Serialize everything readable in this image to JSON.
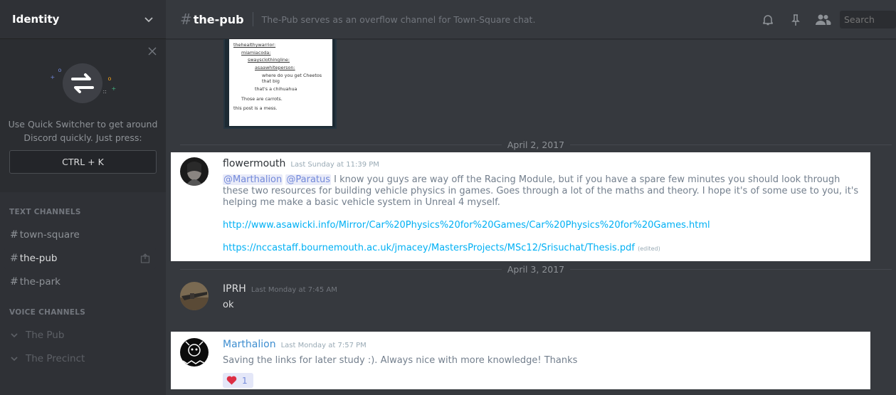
{
  "sidebar": {
    "guild_name": "Identity",
    "quick_switcher": {
      "text": "Use Quick Switcher to get around Discord quickly. Just press:",
      "shortcut": "CTRL + K"
    },
    "text_category": "TEXT CHANNELS",
    "text_channels": [
      {
        "hash": "#",
        "name": "town-square"
      },
      {
        "hash": "#",
        "name": "the-pub"
      },
      {
        "hash": "#",
        "name": "the-park"
      }
    ],
    "voice_category": "VOICE CHANNELS",
    "voice_channels": [
      {
        "name": "The Pub"
      },
      {
        "name": "The Precinct"
      }
    ]
  },
  "header": {
    "hash": "#",
    "channel": "the-pub",
    "topic": "The-Pub serves as an overflow channel for Town-Square chat.",
    "search_placeholder": "Search"
  },
  "embed_lines": [
    "thehealthywarrior:",
    "miamiacoda:",
    "swayscIothingline:",
    "asaawhiteperson:",
    "where do you get Cheetos",
    "that big",
    "that's a chihuahua",
    "Those are carrots.",
    "this post is a mess."
  ],
  "dates": [
    "April 2, 2017",
    "April 3, 2017"
  ],
  "messages": [
    {
      "author": "flowermouth",
      "timestamp": "Last Sunday at 11:39 PM",
      "mention1": "@Marthalion",
      "mention2": "@Paratus",
      "text": " I know you guys are way off the Racing Module, but if you have a spare few minutes you should look through these two resources for building vehicle physics in games. Goes through a lot of the maths and theory. I hope it's of some use to you, it's helping me make a basic vehicle system in Unreal 4 myself.",
      "link1": "http://www.asawicki.info/Mirror/Car%20Physics%20for%20Games/Car%20Physics%20for%20Games.html",
      "link2": "https://nccastaff.bournemouth.ac.uk/jmacey/MastersProjects/MSc12/Srisuchat/Thesis.pdf",
      "edited": "(edited)"
    },
    {
      "author": "IPRH",
      "timestamp": "Last Monday at 7:45 AM",
      "text": "ok"
    },
    {
      "author": "Marthalion",
      "timestamp": "Last Monday at 7:57 PM",
      "text": "Saving the links for later study :). Always nice with more knowledge! Thanks",
      "reaction_count": "1"
    }
  ],
  "colors": {
    "sidebar_bg": "#2f3136",
    "chat_bg": "#36393e",
    "blurple": "#7289da",
    "link": "#00b0f4",
    "heart": "#dd2e44"
  }
}
